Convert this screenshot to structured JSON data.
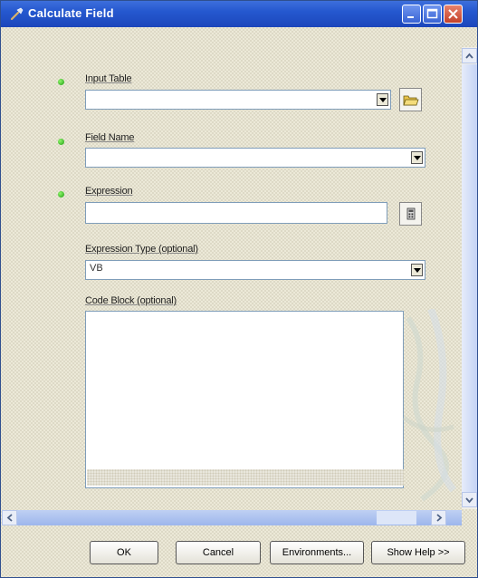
{
  "window": {
    "title": "Calculate Field"
  },
  "form": {
    "input_table": {
      "label": "Input Table",
      "value": ""
    },
    "field_name": {
      "label": "Field Name",
      "value": ""
    },
    "expression": {
      "label": "Expression",
      "value": ""
    },
    "expression_type": {
      "label": "Expression Type (optional)",
      "value": "VB"
    },
    "code_block": {
      "label": "Code Block (optional)",
      "value": ""
    }
  },
  "buttons": {
    "ok": "OK",
    "cancel": "Cancel",
    "environments": "Environments...",
    "show_help": "Show Help >>"
  },
  "icons": {
    "title": "hammer-icon",
    "browse": "folder-open-icon",
    "expression_builder": "calculator-icon"
  },
  "colors": {
    "titlebar": "#2558cf",
    "required_dot": "#2fbf1a",
    "field_border": "#7f9db9",
    "window_bg": "#ece9d8"
  }
}
